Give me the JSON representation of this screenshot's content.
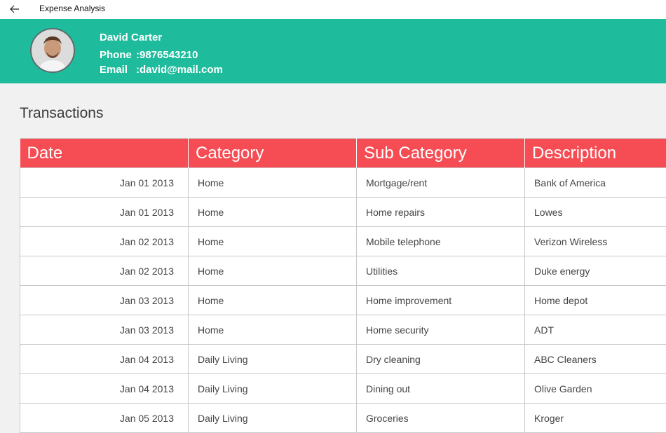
{
  "app": {
    "title": "Expense Analysis"
  },
  "profile": {
    "name": "David Carter",
    "phone_label": "Phone",
    "phone_value": ":9876543210",
    "email_label": "Email",
    "email_value": ":david@mail.com"
  },
  "section": {
    "title": "Transactions"
  },
  "table": {
    "headers": [
      "Date",
      "Category",
      "Sub Category",
      "Description"
    ],
    "rows": [
      [
        "Jan 01 2013",
        "Home",
        "Mortgage/rent",
        "Bank of America"
      ],
      [
        "Jan 01 2013",
        "Home",
        "Home repairs",
        "Lowes"
      ],
      [
        "Jan 02 2013",
        "Home",
        "Mobile telephone",
        "Verizon Wireless"
      ],
      [
        "Jan 02 2013",
        "Home",
        "Utilities",
        "Duke energy"
      ],
      [
        "Jan 03 2013",
        "Home",
        "Home improvement",
        "Home depot"
      ],
      [
        "Jan 03 2013",
        "Home",
        "Home security",
        "ADT"
      ],
      [
        "Jan 04 2013",
        "Daily Living",
        "Dry cleaning",
        "ABC Cleaners"
      ],
      [
        "Jan 04 2013",
        "Daily Living",
        "Dining out",
        "Olive Garden"
      ],
      [
        "Jan 05 2013",
        "Daily Living",
        "Groceries",
        "Kroger"
      ]
    ]
  },
  "colors": {
    "header_bg": "#1ebc9c",
    "table_header_bg": "#f64c54"
  },
  "icons": {
    "back": "back-arrow-icon",
    "avatar": "user-avatar"
  }
}
